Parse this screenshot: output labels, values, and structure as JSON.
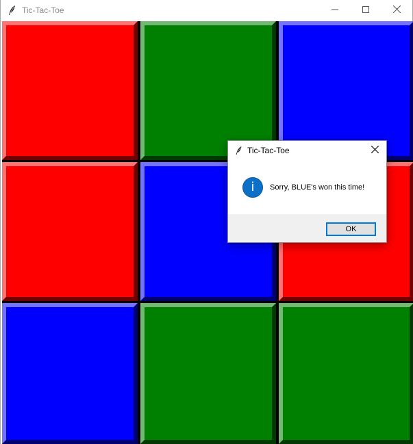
{
  "window": {
    "title": "Tic-Tac-Toe",
    "app_icon": "feather-icon",
    "controls": {
      "minimize_icon": "minimize-icon",
      "maximize_icon": "maximize-icon",
      "close_icon": "close-icon"
    }
  },
  "board": {
    "colors": {
      "red": "#ff0000",
      "green": "#008000",
      "blue": "#0000ff"
    },
    "cells": [
      {
        "row": 1,
        "col": 1,
        "color": "red"
      },
      {
        "row": 1,
        "col": 2,
        "color": "green"
      },
      {
        "row": 1,
        "col": 3,
        "color": "blue"
      },
      {
        "row": 2,
        "col": 1,
        "color": "red"
      },
      {
        "row": 2,
        "col": 2,
        "color": "blue"
      },
      {
        "row": 2,
        "col": 3,
        "color": "red"
      },
      {
        "row": 3,
        "col": 1,
        "color": "blue"
      },
      {
        "row": 3,
        "col": 2,
        "color": "green"
      },
      {
        "row": 3,
        "col": 3,
        "color": "green"
      }
    ]
  },
  "dialog": {
    "title": "Tic-Tac-Toe",
    "icon": "info-icon",
    "message": "Sorry, BLUE's won this time!",
    "ok_label": "OK",
    "accent": "#0078d7"
  }
}
